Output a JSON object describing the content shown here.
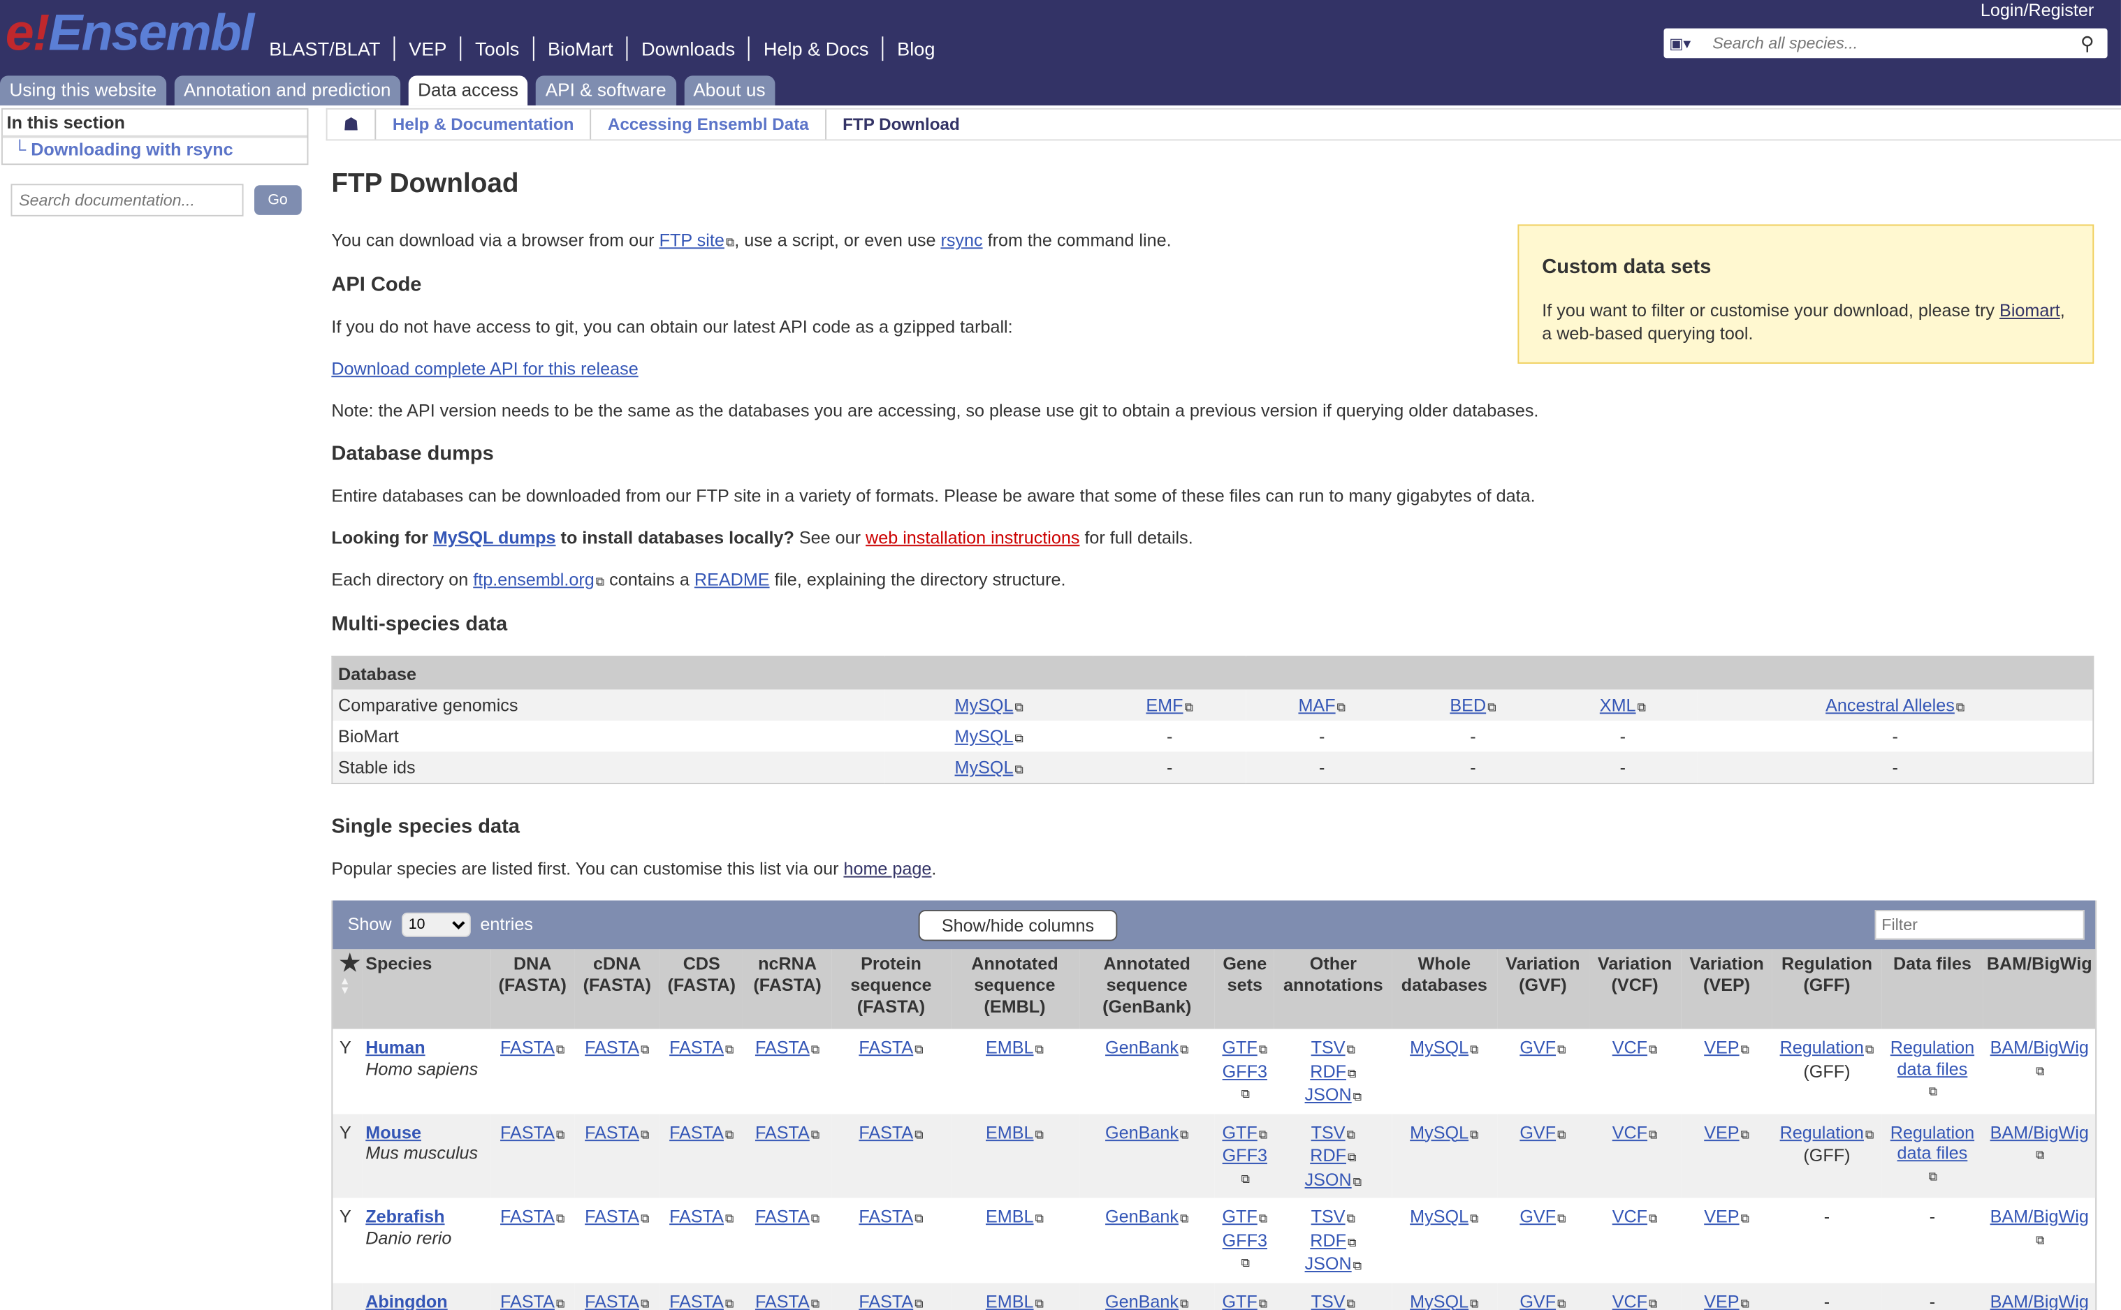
{
  "header": {
    "logo": "Ensembl",
    "login": "Login/Register",
    "search_placeholder": "Search all species...",
    "nav": [
      "BLAST/BLAT",
      "VEP",
      "Tools",
      "BioMart",
      "Downloads",
      "Help & Docs",
      "Blog"
    ],
    "tabs": [
      "Using this website",
      "Annotation and prediction",
      "Data access",
      "API & software",
      "About us"
    ],
    "active_tab": "Data access"
  },
  "sidebar": {
    "section_title": "In this section",
    "items": [
      "Downloading with rsync"
    ],
    "search_placeholder": "Search documentation...",
    "go": "Go"
  },
  "breadcrumb": [
    "Help & Documentation",
    "Accessing Ensembl Data",
    "FTP Download"
  ],
  "page": {
    "title": "FTP Download",
    "intro": [
      "You can download via a browser from our ",
      "FTP site",
      ", use a script, or even use ",
      "rsync",
      " from the command line."
    ],
    "api_heading": "API Code",
    "api_text": "If you do not have access to git, you can obtain our latest API code as a gzipped tarball:",
    "api_link": "Download complete API for this release",
    "api_note": "Note: the API version needs to be the same as the databases you are accessing, so please use git to obtain a previous version if querying older databases.",
    "dumps_heading": "Database dumps",
    "dumps_text": "Entire databases can be downloaded from our FTP site in a variety of formats. Please be aware that some of these files can run to many gigabytes of data.",
    "mysql_line": [
      "Looking for ",
      "MySQL dumps",
      " to install databases locally?",
      " See our ",
      "web installation instructions",
      " for full details."
    ],
    "dir_line": [
      "Each directory on ",
      "ftp.ensembl.org",
      " contains a ",
      "README",
      " file, explaining the directory structure."
    ],
    "multi_heading": "Multi-species data",
    "single_heading": "Single species data",
    "single_text": [
      "Popular species are listed first. You can customise this list via our ",
      "home page",
      "."
    ]
  },
  "custom": {
    "title": "Custom data sets",
    "text": "If you want to filter or customise your download, please try ",
    "link": "Biomart",
    "text2": ", a web-based querying tool."
  },
  "multi_table": {
    "header": "Database",
    "rows": [
      {
        "name": "Comparative genomics",
        "cells": [
          "MySQL",
          "EMF",
          "MAF",
          "BED",
          "XML",
          "Ancestral Alleles"
        ]
      },
      {
        "name": "BioMart",
        "cells": [
          "MySQL",
          "-",
          "-",
          "-",
          "-",
          "-"
        ]
      },
      {
        "name": "Stable ids",
        "cells": [
          "MySQL",
          "-",
          "-",
          "-",
          "-",
          "-"
        ]
      }
    ]
  },
  "species_table": {
    "show": "Show",
    "entries_value": "10",
    "entries": "entries",
    "showhide": "Show/hide columns",
    "filter_placeholder": "Filter",
    "columns": [
      "Species",
      "DNA (FASTA)",
      "cDNA (FASTA)",
      "CDS (FASTA)",
      "ncRNA (FASTA)",
      "Protein sequence (FASTA)",
      "Annotated sequence (EMBL)",
      "Annotated sequence (GenBank)",
      "Gene sets",
      "Other annotations",
      "Whole databases",
      "Variation (GVF)",
      "Variation (VCF)",
      "Variation (VEP)",
      "Regulation (GFF)",
      "Data files",
      "BAM/BigWig"
    ],
    "rows": [
      {
        "fav": "Y",
        "common": "Human",
        "sci": "Homo sapiens",
        "regulation": "Regulation",
        "regulation_sub": "(GFF)",
        "data_files": "Regulation data files"
      },
      {
        "fav": "Y",
        "common": "Mouse",
        "sci": "Mus musculus",
        "regulation": "Regulation",
        "regulation_sub": "(GFF)",
        "data_files": "Regulation data files"
      },
      {
        "fav": "Y",
        "common": "Zebrafish",
        "sci": "Danio rerio",
        "regulation": "-",
        "regulation_sub": "",
        "data_files": "-"
      },
      {
        "fav": "",
        "common": "Abingdon island giant tortoise",
        "sci": "",
        "regulation": "-",
        "regulation_sub": "",
        "data_files": "-"
      }
    ],
    "links": {
      "fasta": "FASTA",
      "embl": "EMBL",
      "genbank": "GenBank",
      "gtf": "GTF",
      "gff3": "GFF3",
      "tsv": "TSV",
      "rdf": "RDF",
      "json": "JSON",
      "mysql": "MySQL",
      "gvf": "GVF",
      "vcf": "VCF",
      "vep": "VEP",
      "bam": "BAM/BigWig"
    }
  },
  "colors": {
    "masthead": "#333366",
    "tab": "#7f8db0",
    "link": "#3456b6"
  }
}
